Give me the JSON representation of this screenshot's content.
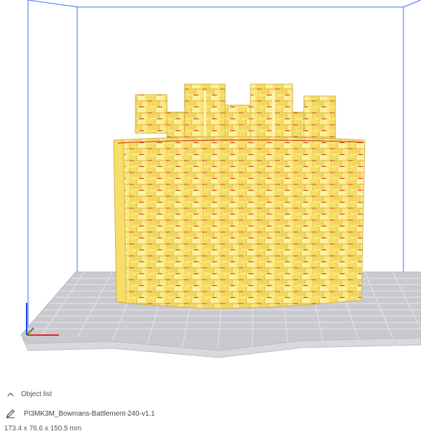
{
  "object_panel": {
    "header_label": "Object list",
    "file_name": "PI3MK3M_Bowmans-Battlement-240-v1.1",
    "dimensions": "173.4 x 76.6 x 150.5 mm"
  },
  "colors": {
    "model_fill": "#fbe77a",
    "model_shade": "#e6cc55",
    "mortar_red": "#d63a2a",
    "build_volume_line": "#3b6cff",
    "plate_fill": "#c9c9cf",
    "plate_grid": "#e9e9ee",
    "axis_x": "#e02020",
    "axis_y": "#20a020",
    "axis_z": "#2040e0"
  },
  "icons": {
    "collapse": "chevron-up-icon",
    "edit": "pencil-icon"
  }
}
